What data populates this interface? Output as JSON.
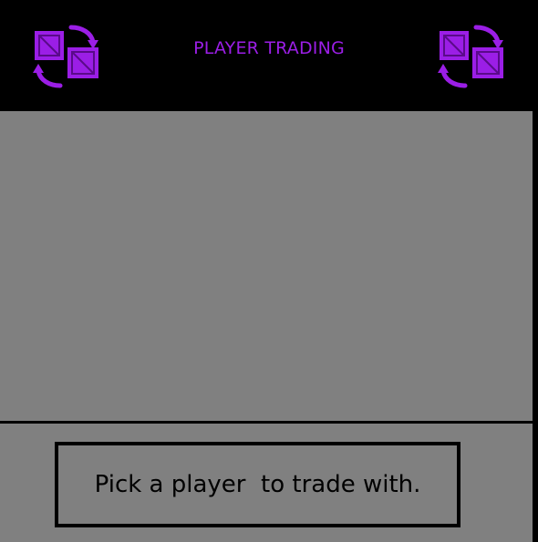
{
  "header": {
    "title": "PLAYER TRADING"
  },
  "icons": {
    "left": "trade-swap-icon",
    "right": "trade-swap-icon"
  },
  "prompt": {
    "text": "Pick a player  to trade with."
  },
  "colors": {
    "accent": "#9b1ee6",
    "accent_dark": "#5a0a8a",
    "panel": "#808080",
    "background": "#000000",
    "text": "#000000"
  }
}
